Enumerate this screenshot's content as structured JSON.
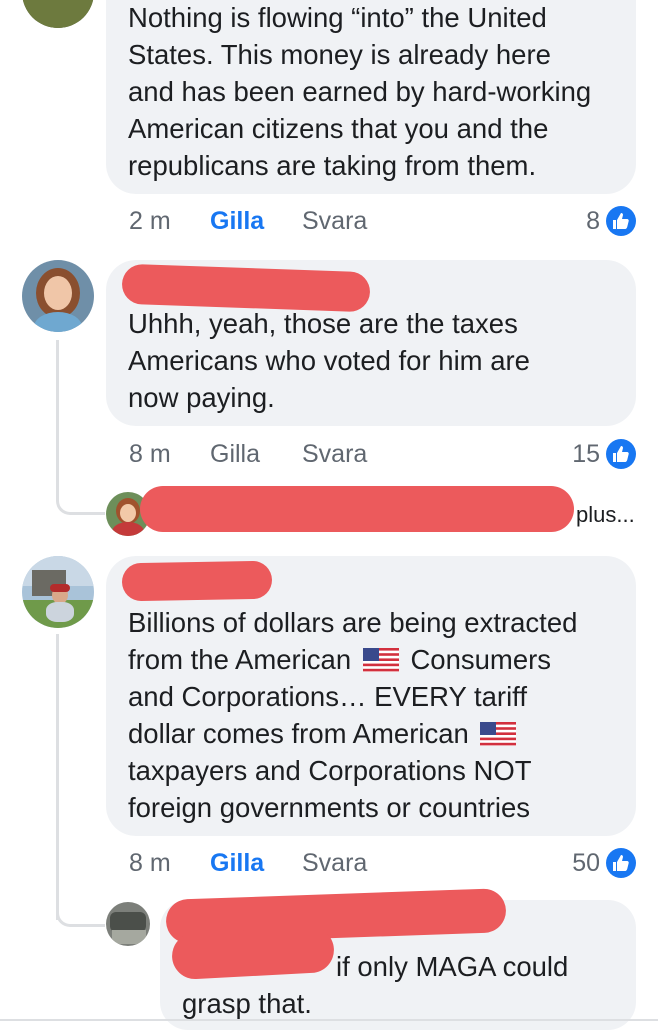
{
  "comments": [
    {
      "lines": [
        "Nothing is flowing “into” the United",
        "States.  This money is already here",
        "and has been earned by hard-working",
        "American citizens that you and the",
        "republicans are taking from them."
      ],
      "time": "2 m",
      "like": "Gilla",
      "reply": "Svara",
      "reactions": "8"
    },
    {
      "lines": [
        "Uhhh, yeah, those are the taxes",
        "Americans who voted for him are",
        "now paying."
      ],
      "time": "8 m",
      "like": "Gilla",
      "reply": "Svara",
      "reactions": "15",
      "collapsed_reply_suffix": "plus..."
    },
    {
      "lines_a": [
        "Billions of dollars are being extracted"
      ],
      "line2_a": "from the American",
      "line2_b": "Consumers",
      "line3": "and Corporations… EVERY tariff",
      "line4_a": "dollar comes from American",
      "lines_b": [
        "taxpayers and Corporations NOT",
        "foreign governments or countries"
      ],
      "time": "8 m",
      "like": "Gilla",
      "reply": "Svara",
      "reactions": "50"
    },
    {
      "line1": "if only MAGA could",
      "line2": "grasp that."
    }
  ],
  "colors": {
    "accent": "#1877f2",
    "bubble": "#f0f2f5",
    "redaction": "#ec5a5c"
  }
}
